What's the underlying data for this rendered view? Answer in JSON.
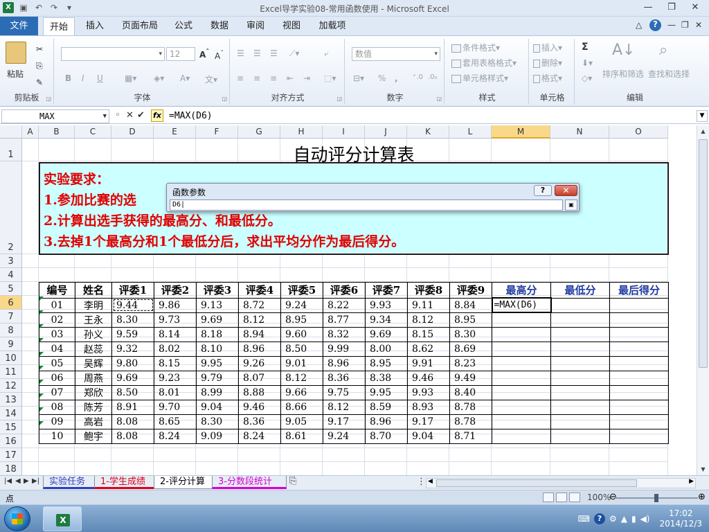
{
  "window": {
    "title": "Excel导学实验08-常用函数使用 - Microsoft Excel"
  },
  "menu": {
    "file": "文件",
    "tabs": [
      {
        "label": "开始"
      },
      {
        "label": "插入"
      },
      {
        "label": "页面布局"
      },
      {
        "label": "公式"
      },
      {
        "label": "数据"
      },
      {
        "label": "审阅"
      },
      {
        "label": "视图"
      },
      {
        "label": "加载项"
      }
    ]
  },
  "ribbon": {
    "clipboard": {
      "label": "剪贴板",
      "paste": "粘贴"
    },
    "font": {
      "label": "字体",
      "size": "12",
      "bold": "B",
      "italic": "I",
      "underline": "U"
    },
    "alignment": {
      "label": "对齐方式"
    },
    "number": {
      "label": "数字",
      "format": "数值",
      "percent": "%",
      "comma": ","
    },
    "styles": {
      "label": "样式",
      "cond": "条件格式",
      "table": "套用表格格式",
      "cell": "单元格样式"
    },
    "cells": {
      "label": "单元格",
      "insert": "插入",
      "delete": "删除",
      "format": "格式"
    },
    "editing": {
      "label": "编辑",
      "sort": "排序和筛选",
      "find": "查找和选择",
      "sigma": "Σ"
    }
  },
  "formula_bar": {
    "name_box": "MAX",
    "formula": "=MAX(D6)"
  },
  "columns": [
    "A",
    "B",
    "C",
    "D",
    "E",
    "F",
    "G",
    "H",
    "I",
    "J",
    "K",
    "L",
    "M",
    "N",
    "O"
  ],
  "rows": [
    "1",
    "2",
    "3",
    "4",
    "5",
    "6",
    "7",
    "8",
    "9",
    "10",
    "11",
    "12",
    "13",
    "14",
    "15",
    "16",
    "17",
    "18"
  ],
  "sheet": {
    "title": "自动评分计算表",
    "requirements": [
      "实验要求：",
      "1.参加比赛的选",
      "2.计算出选手获得的最高分、和最低分。",
      "3.去掉1个最高分和1个最低分后，求出平均分作为最后得分。"
    ],
    "headers": [
      "编号",
      "姓名",
      "评委1",
      "评委2",
      "评委3",
      "评委4",
      "评委5",
      "评委6",
      "评委7",
      "评委8",
      "评委9",
      "最高分",
      "最低分",
      "最后得分"
    ],
    "records": [
      [
        "01",
        "李明",
        "9.44",
        "9.86",
        "9.13",
        "8.72",
        "9.24",
        "8.22",
        "9.93",
        "9.11",
        "8.84",
        "=MAX(D6)",
        "",
        ""
      ],
      [
        "02",
        "王永",
        "8.30",
        "9.73",
        "9.69",
        "8.12",
        "8.95",
        "8.77",
        "9.34",
        "8.12",
        "8.95",
        "",
        "",
        ""
      ],
      [
        "03",
        "孙义",
        "9.59",
        "8.14",
        "8.18",
        "8.94",
        "9.60",
        "8.32",
        "9.69",
        "8.15",
        "8.30",
        "",
        "",
        ""
      ],
      [
        "04",
        "赵蕊",
        "9.32",
        "8.02",
        "8.10",
        "8.96",
        "8.50",
        "9.99",
        "8.00",
        "8.62",
        "8.69",
        "",
        "",
        ""
      ],
      [
        "05",
        "吴辉",
        "9.80",
        "8.15",
        "9.95",
        "9.26",
        "9.01",
        "8.96",
        "8.95",
        "9.91",
        "8.23",
        "",
        "",
        ""
      ],
      [
        "06",
        "周燕",
        "9.69",
        "9.23",
        "9.79",
        "8.07",
        "8.12",
        "8.36",
        "8.38",
        "9.46",
        "9.49",
        "",
        "",
        ""
      ],
      [
        "07",
        "郑欣",
        "8.50",
        "8.01",
        "8.99",
        "8.88",
        "9.66",
        "9.75",
        "9.95",
        "9.93",
        "8.40",
        "",
        "",
        ""
      ],
      [
        "08",
        "陈芳",
        "8.91",
        "9.70",
        "9.04",
        "9.46",
        "8.66",
        "8.12",
        "8.59",
        "8.93",
        "8.78",
        "",
        "",
        ""
      ],
      [
        "09",
        "高岩",
        "8.08",
        "8.65",
        "8.30",
        "8.36",
        "9.05",
        "9.17",
        "8.96",
        "9.17",
        "8.78",
        "",
        "",
        ""
      ],
      [
        "10",
        "鲍宇",
        "8.08",
        "8.24",
        "9.09",
        "8.24",
        "8.61",
        "9.24",
        "8.70",
        "9.04",
        "8.71",
        "",
        "",
        ""
      ]
    ]
  },
  "dialog": {
    "title": "函数参数",
    "help": "?",
    "close": "✕",
    "input": "D6|"
  },
  "sheet_tabs": [
    {
      "label": "实验任务",
      "color": "#2b3fc0",
      "text": "#2b3fc0"
    },
    {
      "label": "1-学生成绩",
      "color": "#e0001b",
      "text": "#e0001b"
    },
    {
      "label": "2-评分计算",
      "color": "#ffffff",
      "text": "#000000"
    },
    {
      "label": "3-分数段统计",
      "color": "#d400d4",
      "text": "#d400d4"
    }
  ],
  "status": {
    "mode": "点",
    "zoom": "100%"
  },
  "taskbar": {
    "time": "17:02",
    "date": "2014/12/3"
  },
  "colors": {
    "accent": "#2b6cb4",
    "req_text": "#e00000",
    "req_bg": "#ccffff",
    "header_blue": "#1f3aa0"
  }
}
